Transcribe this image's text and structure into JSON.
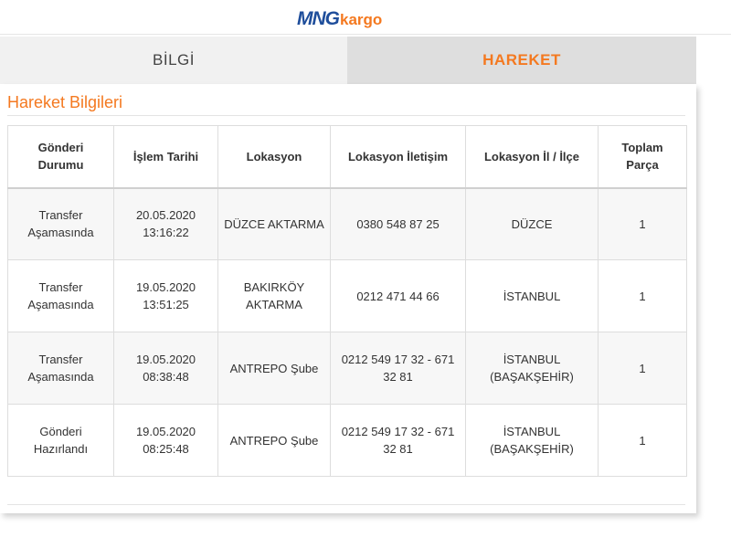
{
  "brand": {
    "name_part1": "MNG",
    "name_part2": "kargo",
    "color_primary": "#1f4e9b",
    "color_accent": "#f47920"
  },
  "tabs": [
    {
      "label": "BİLGİ",
      "active": false
    },
    {
      "label": "HAREKET",
      "active": true
    }
  ],
  "panel": {
    "title": "Hareket Bilgileri"
  },
  "table": {
    "headers": [
      "Gönderi Durumu",
      "İşlem Tarihi",
      "Lokasyon",
      "Lokasyon İletişim",
      "Lokasyon İl / İlçe",
      "Toplam Parça"
    ],
    "rows": [
      {
        "status": "Transfer Aşamasında",
        "date": "20.05.2020 13:16:22",
        "location": "DÜZCE AKTARMA",
        "contact": "0380 548 87 25",
        "city": "DÜZCE",
        "parts": "1"
      },
      {
        "status": "Transfer Aşamasında",
        "date": "19.05.2020 13:51:25",
        "location": "BAKIRKÖY AKTARMA",
        "contact": "0212 471 44 66",
        "city": "İSTANBUL",
        "parts": "1"
      },
      {
        "status": "Transfer Aşamasında",
        "date": "19.05.2020 08:38:48",
        "location": "ANTREPO Şube",
        "contact": "0212 549 17 32 - 671 32 81",
        "city": "İSTANBUL (BAŞAKŞEHİR)",
        "parts": "1"
      },
      {
        "status": "Gönderi Hazırlandı",
        "date": "19.05.2020 08:25:48",
        "location": "ANTREPO Şube",
        "contact": "0212 549 17 32 - 671 32 81",
        "city": "İSTANBUL (BAŞAKŞEHİR)",
        "parts": "1"
      }
    ]
  }
}
